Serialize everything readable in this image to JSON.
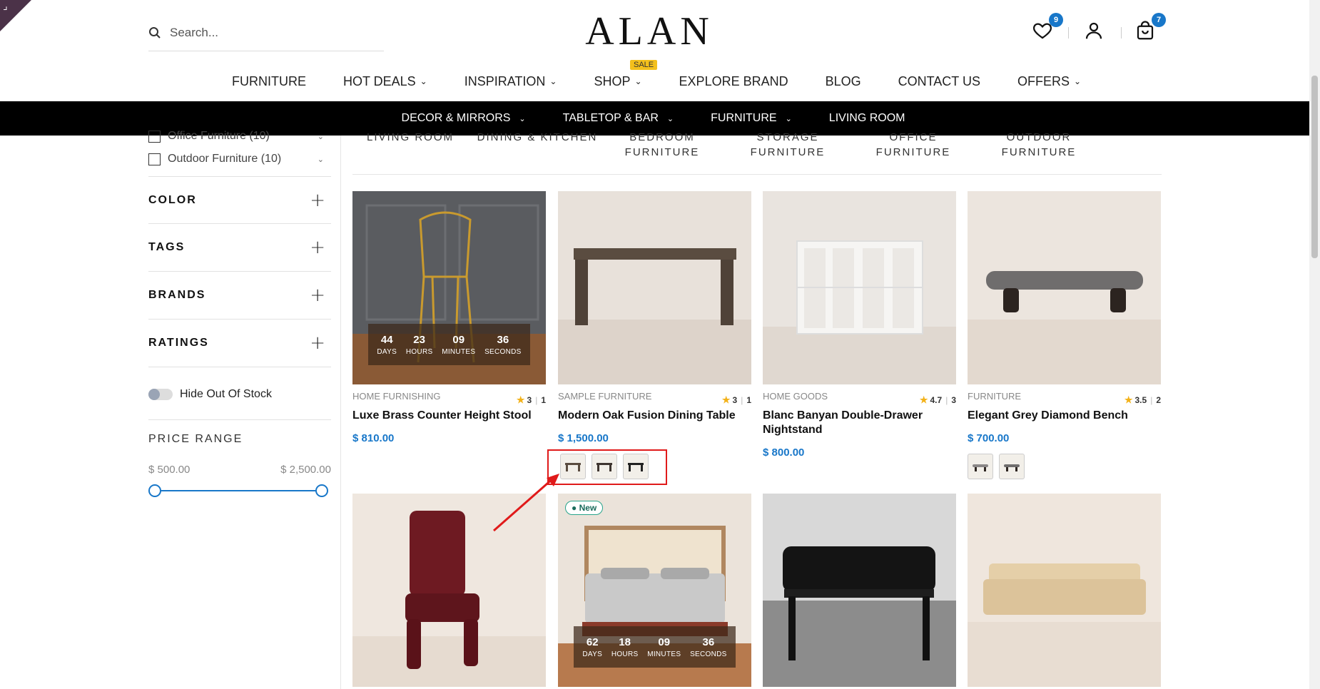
{
  "header": {
    "search_placeholder": "Search...",
    "logo": "ALAN",
    "wishlist_count": "9",
    "cart_count": "7"
  },
  "main_nav": [
    {
      "label": "FURNITURE",
      "has_dropdown": false
    },
    {
      "label": "HOT DEALS",
      "has_dropdown": true
    },
    {
      "label": "INSPIRATION",
      "has_dropdown": true
    },
    {
      "label": "SHOP",
      "has_dropdown": true,
      "badge": "SALE"
    },
    {
      "label": "EXPLORE BRAND",
      "has_dropdown": false
    },
    {
      "label": "BLOG",
      "has_dropdown": false
    },
    {
      "label": "CONTACT US",
      "has_dropdown": false
    },
    {
      "label": "OFFERS",
      "has_dropdown": true
    }
  ],
  "sub_nav": [
    {
      "label": "DECOR & MIRRORS",
      "has_dropdown": true
    },
    {
      "label": "TABLETOP & BAR",
      "has_dropdown": true
    },
    {
      "label": "FURNITURE",
      "has_dropdown": true
    },
    {
      "label": "LIVING ROOM",
      "has_dropdown": false
    }
  ],
  "sidebar": {
    "category_filters": [
      {
        "label": "Office Furniture (10)"
      },
      {
        "label": "Outdoor Furniture (10)"
      }
    ],
    "facets": [
      "COLOR",
      "TAGS",
      "BRANDS",
      "RATINGS"
    ],
    "hide_out_of_stock": "Hide Out Of Stock",
    "price_range": {
      "title": "PRICE RANGE",
      "min": "$ 500.00",
      "max": "$ 2,500.00"
    }
  },
  "category_tabs": [
    {
      "line1": "LIVING ROOM",
      "line2": ""
    },
    {
      "line1": "DINING & KITCHEN",
      "line2": ""
    },
    {
      "line1": "BEDROOM",
      "line2": "FURNITURE"
    },
    {
      "line1": "STORAGE",
      "line2": "FURNITURE"
    },
    {
      "line1": "OFFICE FURNITURE",
      "line2": ""
    },
    {
      "line1": "OUTDOOR",
      "line2": "FURNITURE"
    }
  ],
  "products": [
    {
      "category": "HOME FURNISHING",
      "rating": "3",
      "reviews": "1",
      "name": "Luxe Brass Counter Height Stool",
      "price": "$ 810.00",
      "countdown": {
        "days": "44",
        "hours": "23",
        "minutes": "09",
        "seconds": "36"
      }
    },
    {
      "category": "SAMPLE FURNITURE",
      "rating": "3",
      "reviews": "1",
      "name": "Modern Oak Fusion Dining Table",
      "price": "$ 1,500.00",
      "swatches": 3
    },
    {
      "category": "HOME GOODS",
      "rating": "4.7",
      "reviews": "3",
      "name": "Blanc Banyan Double-Drawer Nightstand",
      "price": "$ 800.00"
    },
    {
      "category": "FURNITURE",
      "rating": "3.5",
      "reviews": "2",
      "name": "Elegant Grey Diamond Bench",
      "price": "$ 700.00",
      "swatches": 2
    }
  ],
  "second_row": {
    "new_badge": "New",
    "countdown": {
      "days": "62",
      "hours": "18",
      "minutes": "09",
      "seconds": "36"
    }
  },
  "countdown_labels": {
    "days": "DAYS",
    "hours": "HOURS",
    "minutes": "MINUTES",
    "seconds": "SECONDS"
  },
  "colors": {
    "accent": "#1877c9",
    "highlight": "#e01a1a",
    "badge_sale": "#f3c01c"
  }
}
